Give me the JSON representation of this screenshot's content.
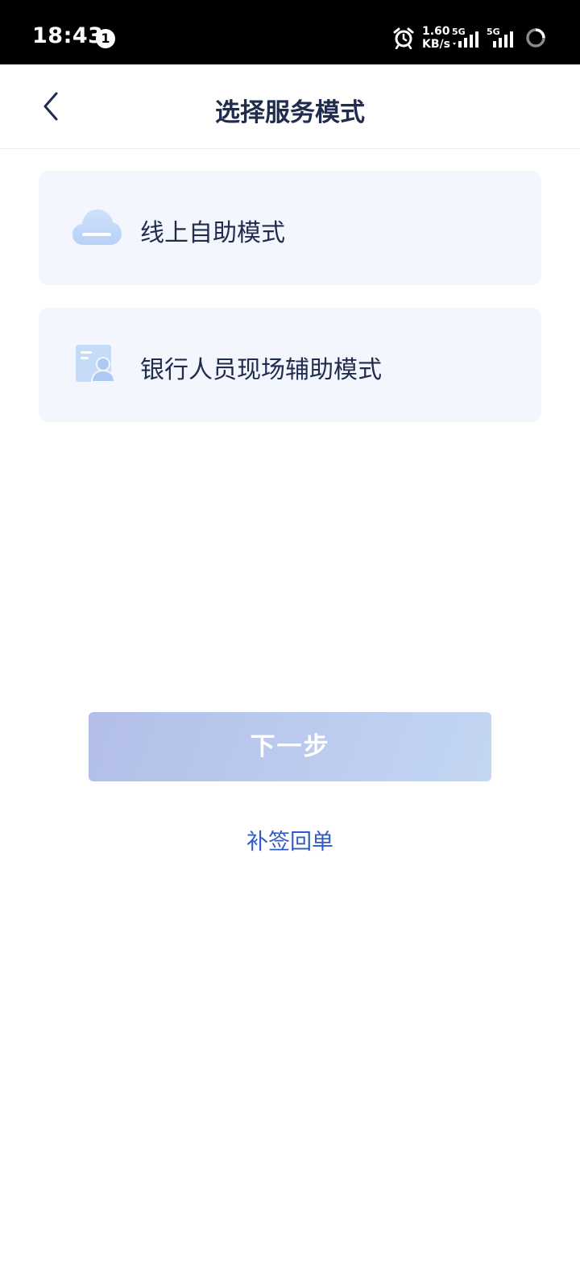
{
  "status_bar": {
    "time": "18:43",
    "notification_count": "1",
    "net_speed_value": "1.60",
    "net_speed_unit": "KB/s",
    "sim1_label": "5G",
    "sim2_label": "5G"
  },
  "nav": {
    "title": "选择服务模式"
  },
  "modes": [
    {
      "label": "线上自助模式",
      "icon": "cloud-icon"
    },
    {
      "label": "银行人员现场辅助模式",
      "icon": "staff-card-icon"
    }
  ],
  "actions": {
    "next_label": "下一步",
    "resign_label": "补签回单"
  },
  "colors": {
    "title_text": "#1f2c4d",
    "card_bg": "#f3f6fc",
    "button_gradient_start": "#b2bee8",
    "button_gradient_end": "#c3d6f3",
    "link": "#2f5bc7"
  }
}
